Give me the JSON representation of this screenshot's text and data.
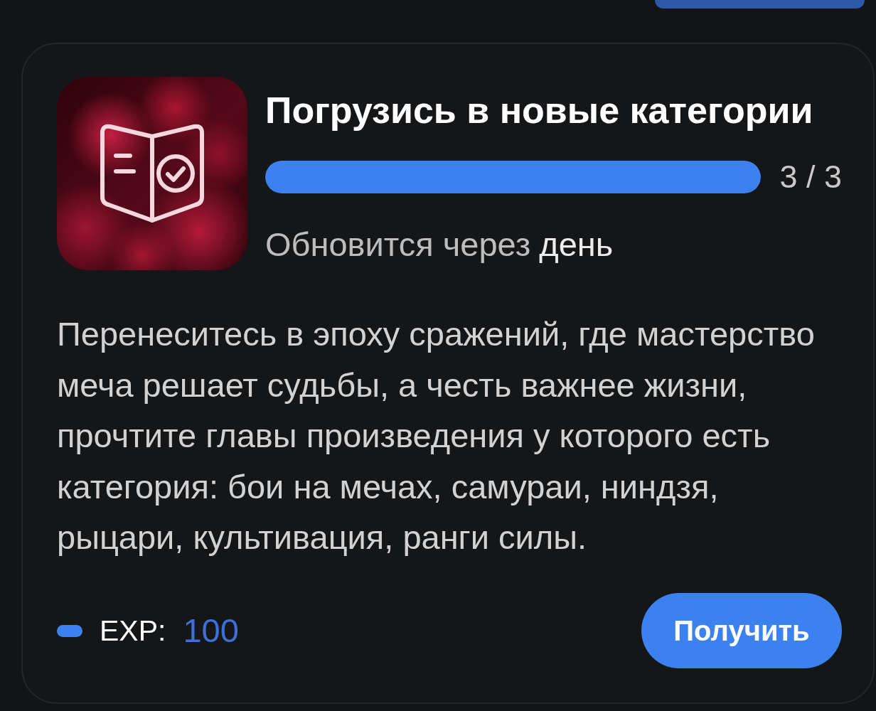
{
  "quest": {
    "title": "Погрузись в новые категории",
    "progress": {
      "level": 1,
      "reading": "3 / 3"
    },
    "refresh_label": "Обновится через",
    "refresh_time": "день",
    "description": "Перенеситесь в эпоху сражений, где мастерство меча решает судьбы, а честь важнее жизни, прочтите главы произведения у которого есть категория: бои на мечах, самураи, ниндзя, рыцари, культивация, ранги силы.",
    "reward": {
      "label": "EXP:",
      "value": "100"
    },
    "claim_button": "Получить"
  }
}
